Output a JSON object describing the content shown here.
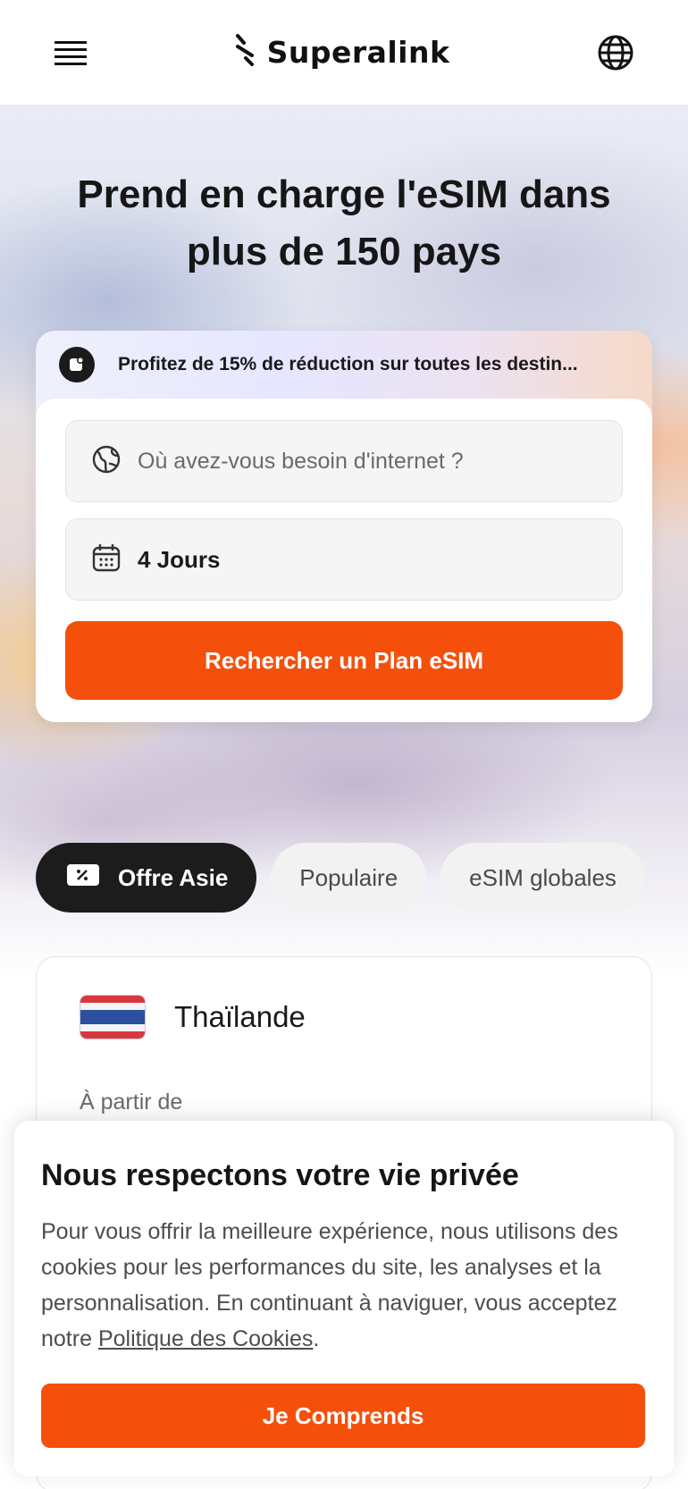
{
  "header": {
    "brand": "Superalink",
    "menu_icon": "hamburger-menu-icon",
    "language_icon": "globe-icon"
  },
  "hero": {
    "title_line1": "Prend en charge l'eSIM dans",
    "title_line2": "plus de 150 pays"
  },
  "search_card": {
    "promo_text": "Profitez de 15% de réduction sur toutes les destin...",
    "destination_placeholder": "Où avez-vous besoin d'internet ?",
    "duration_value": "4 Jours",
    "search_button": "Rechercher un Plan eSIM"
  },
  "tabs": [
    {
      "label": "Offre Asie",
      "active": true
    },
    {
      "label": "Populaire",
      "active": false
    },
    {
      "label": "eSIM globales",
      "active": false
    }
  ],
  "country_card": {
    "name": "Thaïlande",
    "from_label": "À partir de"
  },
  "cookie_banner": {
    "title": "Nous respectons votre vie privée",
    "body": "Pour vous offrir la meilleure expérience, nous utilisons des cookies pour les performances du site, les analyses et la personnalisation. En continuant à naviguer, vous acceptez notre ",
    "link": "Politique des Cookies",
    "body_end": ".",
    "button": "Je Comprends"
  },
  "colors": {
    "accent": "#f4500c",
    "dark": "#1c1c1c"
  }
}
